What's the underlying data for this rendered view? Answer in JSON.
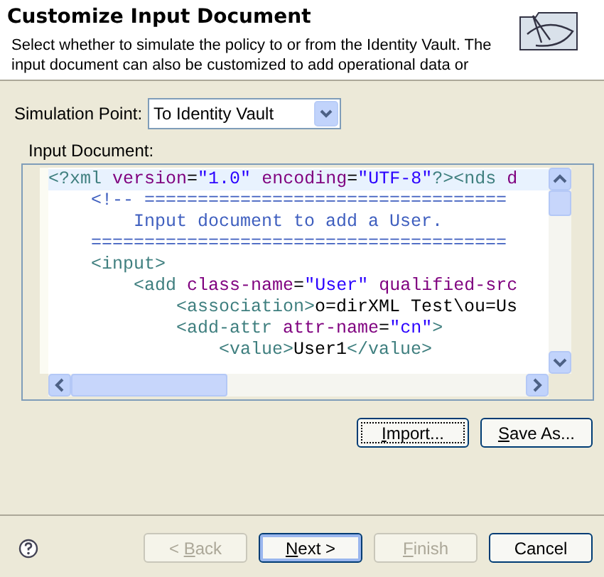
{
  "header": {
    "title": "Customize Input Document",
    "description": "Select whether to simulate the policy to or from the Identity Vault. The input document can also be customized to add operational data or"
  },
  "simulation_point": {
    "label": "Simulation Point:",
    "value": "To Identity Vault"
  },
  "input_document": {
    "label": "Input Document:",
    "lines": [
      {
        "highlighted": true,
        "segments": [
          {
            "kind": "tag",
            "text": "<?xml "
          },
          {
            "kind": "attr",
            "text": "version"
          },
          {
            "kind": "text",
            "text": "="
          },
          {
            "kind": "string",
            "text": "\"1.0\""
          },
          {
            "kind": "attr",
            "text": " encoding"
          },
          {
            "kind": "text",
            "text": "="
          },
          {
            "kind": "string",
            "text": "\"UTF-8\""
          },
          {
            "kind": "tag",
            "text": "?><nds "
          },
          {
            "kind": "attr",
            "text": "d"
          }
        ]
      },
      {
        "highlighted": false,
        "segments": [
          {
            "kind": "comment",
            "text": "    <!-- =================================="
          }
        ]
      },
      {
        "highlighted": false,
        "segments": [
          {
            "kind": "comment",
            "text": "        Input document to add a User."
          }
        ]
      },
      {
        "highlighted": false,
        "segments": [
          {
            "kind": "comment",
            "text": "    ======================================="
          }
        ]
      },
      {
        "highlighted": false,
        "segments": [
          {
            "kind": "tag",
            "text": "    <input>"
          }
        ]
      },
      {
        "highlighted": false,
        "segments": [
          {
            "kind": "tag",
            "text": "        <add "
          },
          {
            "kind": "attr",
            "text": "class-name"
          },
          {
            "kind": "text",
            "text": "="
          },
          {
            "kind": "string",
            "text": "\"User\""
          },
          {
            "kind": "attr",
            "text": " qualified-src"
          }
        ]
      },
      {
        "highlighted": false,
        "segments": [
          {
            "kind": "tag",
            "text": "            <association>"
          },
          {
            "kind": "text",
            "text": "o=dirXML Test\\ou=Us"
          }
        ]
      },
      {
        "highlighted": false,
        "segments": [
          {
            "kind": "tag",
            "text": "            <add-attr "
          },
          {
            "kind": "attr",
            "text": "attr-name"
          },
          {
            "kind": "text",
            "text": "="
          },
          {
            "kind": "string",
            "text": "\"cn\""
          },
          {
            "kind": "tag",
            "text": ">"
          }
        ]
      },
      {
        "highlighted": false,
        "segments": [
          {
            "kind": "tag",
            "text": "                <value>"
          },
          {
            "kind": "text",
            "text": "User1"
          },
          {
            "kind": "tag",
            "text": "</value>"
          }
        ]
      }
    ]
  },
  "document_buttons": [
    {
      "label_parts": [
        {
          "text": "I",
          "underlined": true
        },
        {
          "text": "mport...",
          "underlined": false
        }
      ],
      "focused": true,
      "disabled": false
    },
    {
      "label_parts": [
        {
          "text": "S",
          "underlined": true
        },
        {
          "text": "ave As...",
          "underlined": false
        }
      ],
      "focused": false,
      "disabled": false
    }
  ],
  "footer_buttons": [
    {
      "label_parts": [
        {
          "text": "< ",
          "underlined": false
        },
        {
          "text": "B",
          "underlined": true
        },
        {
          "text": "ack",
          "underlined": false
        }
      ],
      "disabled": true,
      "default": false
    },
    {
      "label_parts": [
        {
          "text": "N",
          "underlined": true
        },
        {
          "text": "ext >",
          "underlined": false
        }
      ],
      "disabled": false,
      "default": true
    },
    {
      "label_parts": [
        {
          "text": "F",
          "underlined": true
        },
        {
          "text": "inish",
          "underlined": false
        }
      ],
      "disabled": true,
      "default": false
    },
    {
      "label_parts": [
        {
          "text": "Cancel",
          "underlined": false
        }
      ],
      "disabled": false,
      "default": false
    }
  ]
}
